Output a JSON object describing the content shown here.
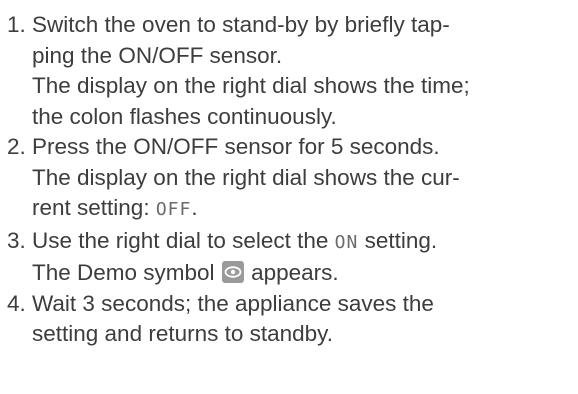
{
  "steps": [
    {
      "number": "1.",
      "lines": [
        "Switch the oven to stand-by by briefly tap-",
        "ping the ON/OFF sensor.",
        "The display on the right dial shows the time;",
        "the colon flashes continuously."
      ]
    },
    {
      "number": "2.",
      "lines": [
        "Press the ON/OFF sensor for 5 seconds.",
        "The display on the right dial shows the cur-"
      ],
      "line3_prefix": "rent setting: ",
      "line3_display": "OFF",
      "line3_suffix": "."
    },
    {
      "number": "3.",
      "line1_prefix": "Use the right dial to select the ",
      "line1_display": "ON",
      "line1_suffix": " setting.",
      "line2_prefix": "The Demo symbol ",
      "line2_icon": "demo-eye-icon",
      "line2_suffix": " appears."
    },
    {
      "number": "4.",
      "lines": [
        "Wait 3 seconds; the appliance saves the",
        "setting and returns to standby."
      ]
    }
  ]
}
